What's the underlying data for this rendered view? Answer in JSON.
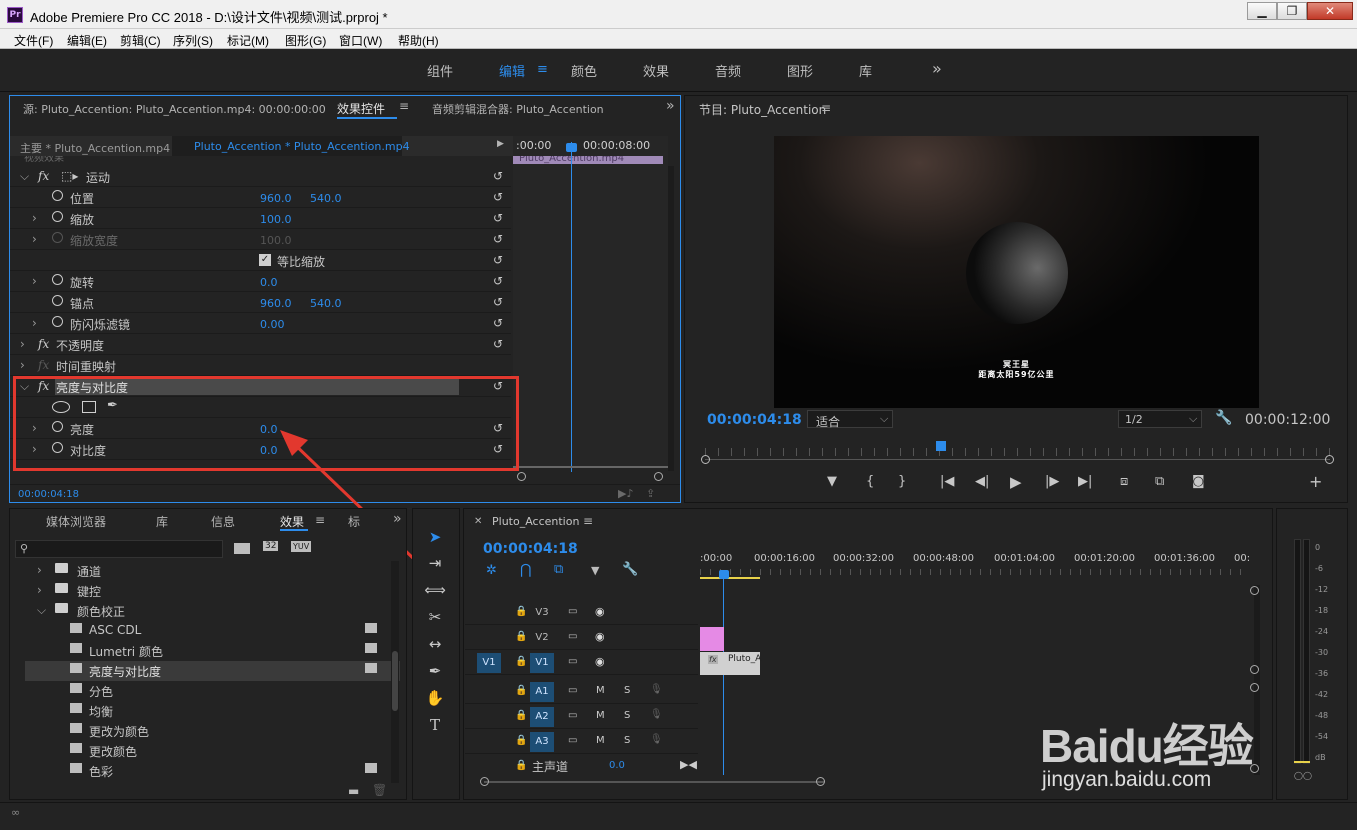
{
  "window": {
    "app_icon": "Pr",
    "title": "Adobe Premiere Pro CC 2018 - D:\\设计文件\\视频\\测试.prproj *",
    "buttons": [
      "minimize-icon",
      "maximize-icon",
      "close-icon"
    ]
  },
  "menu": [
    "文件(F)",
    "编辑(E)",
    "剪辑(C)",
    "序列(S)",
    "标记(M)",
    "图形(G)",
    "窗口(W)",
    "帮助(H)"
  ],
  "workspaces": {
    "items": [
      "组件",
      "编辑",
      "颜色",
      "效果",
      "音频",
      "图形",
      "库"
    ],
    "active": "编辑",
    "more": "»"
  },
  "source_panel": {
    "tabs": [
      "源: Pluto_Accention: Pluto_Accention.mp4: 00:00:00:00",
      "效果控件",
      "音频剪辑混合器: Pluto_Accention"
    ],
    "active_tab": "效果控件",
    "master_clip": "主要 * Pluto_Accention.mp4",
    "sequence_clip": "Pluto_Accention * Pluto_Accention.mp4",
    "section_label": "视频效果",
    "timecodes": [
      ":00:00",
      "00:00:08:00"
    ],
    "clip_label": "Pluto_Accention.mp4",
    "current_time": "00:00:04:18",
    "rows": [
      {
        "label": "运动",
        "type": "effect",
        "fx": "fx"
      },
      {
        "label": "位置",
        "v1": "960.0",
        "v2": "540.0"
      },
      {
        "label": "缩放",
        "v1": "100.0"
      },
      {
        "label": "缩放宽度",
        "v1": "100.0",
        "disabled": true
      },
      {
        "label": "等比缩放",
        "type": "checkbox",
        "checked": true
      },
      {
        "label": "旋转",
        "v1": "0.0"
      },
      {
        "label": "锚点",
        "v1": "960.0",
        "v2": "540.0"
      },
      {
        "label": "防闪烁滤镜",
        "v1": "0.00"
      },
      {
        "label": "不透明度",
        "type": "effect",
        "fx": "fx"
      },
      {
        "label": "时间重映射",
        "type": "effect",
        "fx": "fx",
        "disabled": true
      },
      {
        "label": "亮度与对比度",
        "type": "effect",
        "fx": "fx",
        "selected": true
      },
      {
        "label": "",
        "type": "masks"
      },
      {
        "label": "亮度",
        "v1": "0.0"
      },
      {
        "label": "对比度",
        "v1": "0.0"
      }
    ]
  },
  "program_panel": {
    "title": "节目: Pluto_Accention",
    "caption_line1": "冥王星",
    "caption_line2": "距离太阳59亿公里",
    "current_time": "00:00:04:18",
    "fit": "适合",
    "resolution": "1/2",
    "duration": "00:00:12:00"
  },
  "effects_panel": {
    "tabs": [
      "媒体浏览器",
      "库",
      "信息",
      "效果",
      "标"
    ],
    "active_tab": "效果",
    "search_placeholder": "",
    "filter_badges": [
      "32",
      "YUV"
    ],
    "items": [
      {
        "label": "通道",
        "type": "folder",
        "indent": 0
      },
      {
        "label": "键控",
        "type": "folder",
        "indent": 0
      },
      {
        "label": "颜色校正",
        "type": "folder",
        "indent": 0,
        "open": true
      },
      {
        "label": "ASC CDL",
        "type": "effect",
        "indent": 1
      },
      {
        "label": "Lumetri 颜色",
        "type": "effect",
        "indent": 1
      },
      {
        "label": "亮度与对比度",
        "type": "effect",
        "indent": 1,
        "selected": true
      },
      {
        "label": "分色",
        "type": "effect",
        "indent": 1
      },
      {
        "label": "均衡",
        "type": "effect",
        "indent": 1
      },
      {
        "label": "更改为颜色",
        "type": "effect",
        "indent": 1
      },
      {
        "label": "更改颜色",
        "type": "effect",
        "indent": 1
      },
      {
        "label": "色彩",
        "type": "effect",
        "indent": 1
      }
    ]
  },
  "timeline": {
    "title": "Pluto_Accention",
    "current_time": "00:00:04:18",
    "ruler": [
      ":00:00",
      "00:00:16:00",
      "00:00:32:00",
      "00:00:48:00",
      "00:01:04:00",
      "00:01:20:00",
      "00:01:36:00",
      "00:"
    ],
    "video_tracks": [
      "V3",
      "V2",
      "V1"
    ],
    "audio_tracks": [
      "A1",
      "A2",
      "A3"
    ],
    "source_patch_v": "V1",
    "master": {
      "label": "主声道",
      "value": "0.0"
    },
    "clip_label": "Pluto_A",
    "mute": "M",
    "solo": "S"
  },
  "meter": {
    "scale": [
      "0",
      "-6",
      "-12",
      "-18",
      "-24",
      "-30",
      "-36",
      "-42",
      "-48",
      "-54",
      "dB"
    ]
  },
  "watermark": {
    "text": "Baidu经验",
    "url": "jingyan.baidu.com"
  }
}
